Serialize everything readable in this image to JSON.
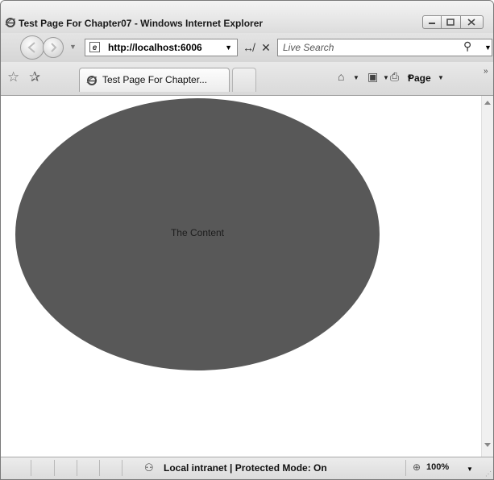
{
  "window": {
    "title": "Test Page For Chapter07 - Windows Internet Explorer",
    "minimize_icon": "minimize-icon",
    "maximize_icon": "maximize-icon",
    "close_icon": "close-icon"
  },
  "navigation": {
    "back_icon": "back-arrow-icon",
    "forward_icon": "forward-arrow-icon",
    "address": "http://localhost:6006",
    "refresh_icon": "refresh-icon",
    "stop_icon": "stop-icon",
    "search_placeholder": "Live Search",
    "search_icon": "search-icon"
  },
  "tabs": {
    "favorites_icon": "favorites-star-icon",
    "add_favorites_icon": "add-favorites-icon",
    "items": [
      {
        "label": "Test Page For Chapter..."
      }
    ]
  },
  "toolbar": {
    "home_icon": "home-icon",
    "feeds_icon": "rss-feed-icon",
    "print_icon": "print-icon",
    "page_label": "Page",
    "more_icon": "chevron-more-icon"
  },
  "content": {
    "ellipse_text": "The Content",
    "ellipse_color": "#585858"
  },
  "statusbar": {
    "zone_text": "Local intranet | Protected Mode: On",
    "zoom": "100%"
  }
}
